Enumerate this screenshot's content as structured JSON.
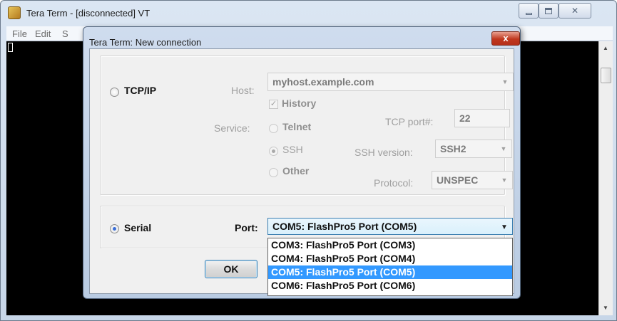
{
  "main_window": {
    "title": "Tera Term - [disconnected] VT",
    "menu": {
      "file": "File",
      "edit": "Edit",
      "setup": "S"
    },
    "close_glyph": "✕"
  },
  "dialog": {
    "title": "Tera Term: New connection",
    "close_glyph": "x",
    "tcpip": {
      "label": "TCP/IP",
      "host_label": "Host:",
      "host_value": "myhost.example.com",
      "history_label": "History",
      "history_checked": true,
      "service_label": "Service:",
      "telnet_label": "Telnet",
      "ssh_label": "SSH",
      "other_label": "Other",
      "tcp_port_label": "TCP port#:",
      "tcp_port_value": "22",
      "ssh_version_label": "SSH version:",
      "ssh_version_value": "SSH2",
      "protocol_label": "Protocol:",
      "protocol_value": "UNSPEC"
    },
    "serial": {
      "label": "Serial",
      "port_label": "Port:",
      "port_value": "COM5: FlashPro5 Port (COM5)",
      "options": [
        "COM3: FlashPro5 Port (COM3)",
        "COM4: FlashPro5 Port (COM4)",
        "COM5: FlashPro5 Port (COM5)",
        "COM6: FlashPro5 Port (COM6)"
      ],
      "selected_index": 2
    },
    "ok_label": "OK"
  },
  "colors": {
    "selection": "#3399ff",
    "terminal_bg": "#000000",
    "dialog_close": "#c0381f"
  }
}
